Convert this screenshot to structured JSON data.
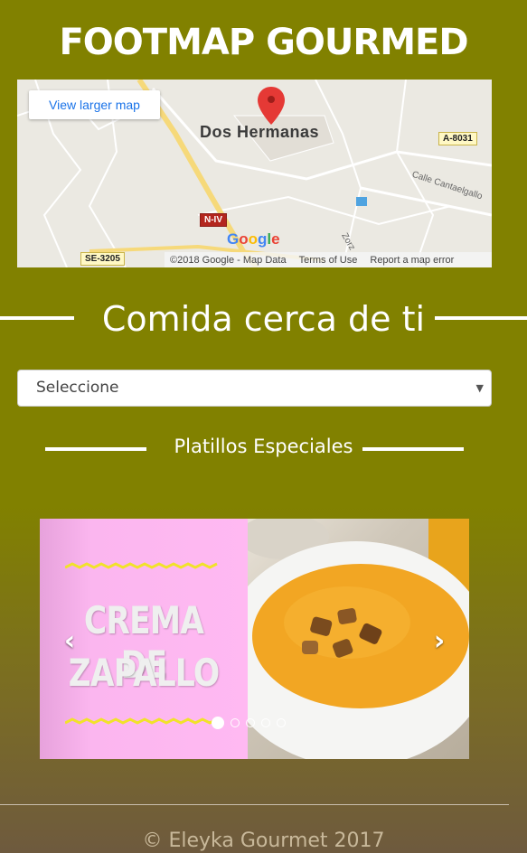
{
  "header": {
    "title": "FOOTMAP GOURMED"
  },
  "map": {
    "view_larger_label": "View larger map",
    "city_label": "Dos Hermanas",
    "road_labels": [
      "A-8031",
      "N-IV",
      "SE-3205"
    ],
    "street_labels": [
      "Calle Cantaelgallo",
      "Zorz"
    ],
    "logo_text": "Google",
    "attribution": {
      "copyright": "©2018 Google - Map Data",
      "terms": "Terms of Use",
      "report": "Report a map error"
    },
    "colors": {
      "pin": "#e53935",
      "road": "#f6d97a",
      "button_text": "#1a73e8"
    }
  },
  "nearby": {
    "heading": "Comida cerca de ti",
    "select_value": "Seleccione"
  },
  "specials": {
    "heading": "Platillos Especiales",
    "slide_title_line1": "CREMA DE",
    "slide_title_line2": "ZAPALLO",
    "prev_icon": "‹",
    "next_icon": "›",
    "indicator_count": 5,
    "active_indicator": 1
  },
  "footer": {
    "text": "© Eleyka Gourmet 2017"
  },
  "colors": {
    "background": "#818100",
    "slide_pink": "#ffb9f2",
    "soup": "#f2a623"
  }
}
